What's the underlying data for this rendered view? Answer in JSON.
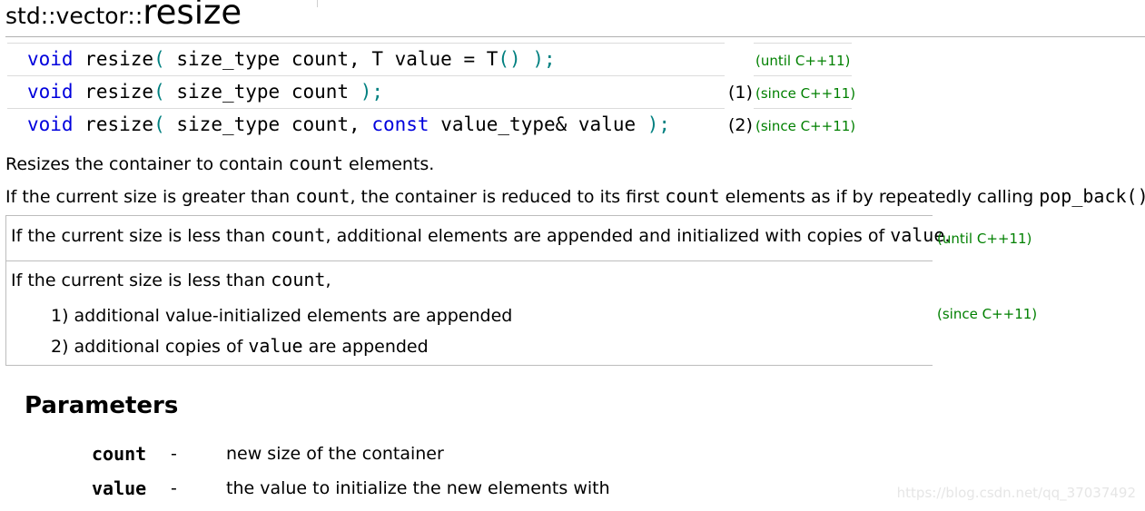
{
  "title": {
    "prefix": "std::vector::",
    "main": "resize"
  },
  "declarations": [
    {
      "kw": "void",
      "name": " resize",
      "open": "(",
      "args": " size_type count, T value = T",
      "inner": "()",
      "close": " );",
      "num": "",
      "mark": "(until C++11)"
    },
    {
      "kw": "void",
      "name": " resize",
      "open": "(",
      "args": " size_type count ",
      "close": ");",
      "num": "(1)",
      "mark": "(since C++11)"
    },
    {
      "kw": "void",
      "name": " resize",
      "open": "(",
      "args_pre": " size_type count, ",
      "kw2": "const",
      "args_post": " value_type& value ",
      "close": ");",
      "num": "(2)",
      "mark": "(since C++11)"
    }
  ],
  "desc": {
    "p1_a": "Resizes the container to contain ",
    "p1_code": "count",
    "p1_b": " elements.",
    "p2_a": "If the current size is greater than ",
    "p2_code1": "count",
    "p2_b": ", the container is reduced to its first ",
    "p2_code2": "count",
    "p2_c": " elements as if by repeatedly calling ",
    "p2_code3": "pop_back()",
    "p2_d": "."
  },
  "box": {
    "row1_a": "If the current size is less than ",
    "row1_code1": "count",
    "row1_b": ", additional elements are appended and initialized with copies of ",
    "row1_code2": "value",
    "row1_c": ".",
    "row1_mark": "(until C++11)",
    "row2_a": "If the current size is less than ",
    "row2_code": "count",
    "row2_b": ",",
    "item1": "1) additional value-initialized elements are appended",
    "item2_a": "2) additional copies of ",
    "item2_code": "value",
    "item2_b": " are appended",
    "row2_mark": "(since C++11)"
  },
  "parameters": {
    "heading": "Parameters",
    "items": [
      {
        "name": "count",
        "dash": "-",
        "desc": "new size of the container"
      },
      {
        "name": "value",
        "dash": "-",
        "desc": "the value to initialize the new elements with"
      }
    ]
  },
  "watermark": "https://blog.csdn.net/qq_37037492",
  "colors": {
    "keyword": "#0000dd",
    "paren": "#008080",
    "mark": "#008000"
  }
}
